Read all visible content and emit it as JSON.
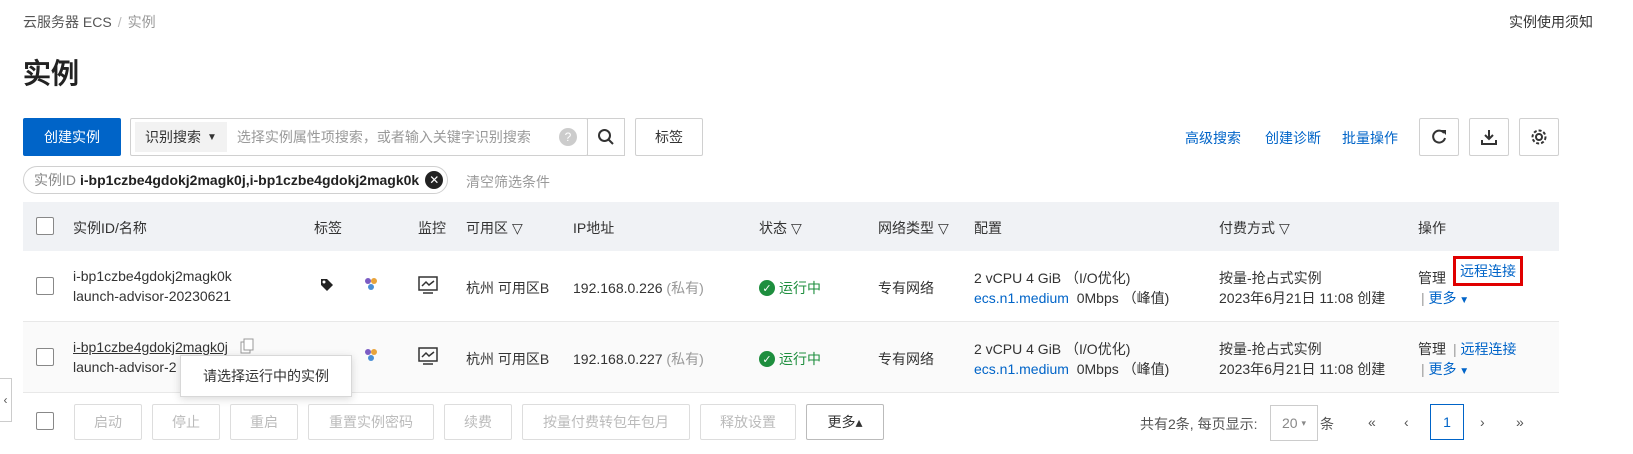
{
  "breadcrumb": {
    "root": "云服务器 ECS",
    "separator": "/",
    "current": "实例"
  },
  "help_link": "实例使用须知",
  "page_title": "实例",
  "toolbar": {
    "create_label": "创建实例",
    "search_type": "识别搜索",
    "search_placeholder": "选择实例属性项搜索，或者输入关键字识别搜索",
    "help_mark": "?",
    "tag_label": "标签",
    "advanced_search": "高级搜索",
    "create_diagnosis": "创建诊断",
    "batch_ops": "批量操作"
  },
  "filter": {
    "key": "实例ID",
    "value": "i-bp1czbe4gdokj2magk0j,i-bp1czbe4gdokj2magk0k",
    "clear_label": "清空筛选条件"
  },
  "table": {
    "headers": {
      "id_name": "实例ID/名称",
      "tags": "标签",
      "monitor": "监控",
      "zone": "可用区",
      "ip": "IP地址",
      "status": "状态",
      "network": "网络类型",
      "config": "配置",
      "billing": "付费方式",
      "actions": "操作"
    },
    "rows": [
      {
        "id": "i-bp1czbe4gdokj2magk0k",
        "name": "launch-advisor-20230621",
        "zone": "杭州 可用区B",
        "ip": "192.168.0.226",
        "ip_note": "(私有)",
        "status": "运行中",
        "network": "专有网络",
        "config_line1": "2 vCPU 4 GiB （I/O优化)",
        "instance_type": "ecs.n1.medium",
        "bandwidth": "0Mbps （峰值)",
        "billing_line1": "按量-抢占式实例",
        "billing_line2": "2023年6月21日 11:08 创建",
        "manage": "管理",
        "remote": "远程连接",
        "more": "更多"
      },
      {
        "id": "i-bp1czbe4gdokj2magk0j",
        "name": "launch-advisor-2",
        "zone": "杭州 可用区B",
        "ip": "192.168.0.227",
        "ip_note": "(私有)",
        "status": "运行中",
        "network": "专有网络",
        "config_line1": "2 vCPU 4 GiB （I/O优化)",
        "instance_type": "ecs.n1.medium",
        "bandwidth": "0Mbps （峰值)",
        "billing_line1": "按量-抢占式实例",
        "billing_line2": "2023年6月21日 11:08 创建",
        "manage": "管理",
        "remote": "远程连接",
        "more": "更多"
      }
    ]
  },
  "tooltip": "请选择运行中的实例",
  "footer": {
    "start": "启动",
    "stop": "停止",
    "restart": "重启",
    "reset_password": "重置实例密码",
    "renew": "续费",
    "convert": "按量付费转包年包月",
    "release": "释放设置",
    "more": "更多▴",
    "total_text": "共有2条, 每页显示:",
    "page_size": "20",
    "page_unit": "条",
    "current_page": "1"
  },
  "colors": {
    "primary": "#0064c8",
    "running": "#1e8e3e",
    "highlight": "#e00000"
  }
}
